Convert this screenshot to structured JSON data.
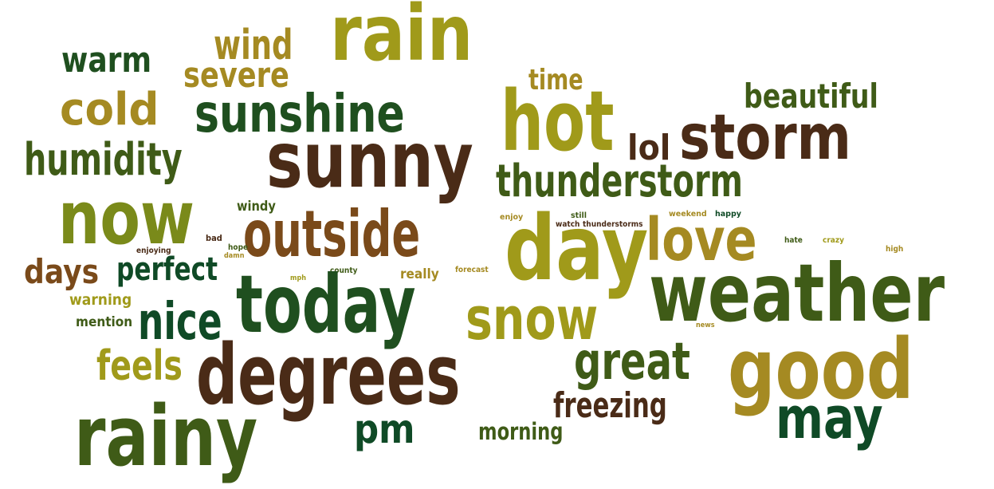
{
  "palette": {
    "dark_green": "#1f4f1f",
    "forest_green": "#3f5b17",
    "deep_green": "#0f4a26",
    "olive": "#a09a1a",
    "mustard": "#a58a22",
    "brown": "#7a4a1a",
    "dark_brown": "#4a2b17",
    "olive_green": "#7a8a1a"
  },
  "words": [
    {
      "text": "rain"
    },
    {
      "text": "wind"
    },
    {
      "text": "warm"
    },
    {
      "text": "severe"
    },
    {
      "text": "time"
    },
    {
      "text": "cold"
    },
    {
      "text": "sunshine"
    },
    {
      "text": "hot"
    },
    {
      "text": "beautiful"
    },
    {
      "text": "storm"
    },
    {
      "text": "lol"
    },
    {
      "text": "humidity"
    },
    {
      "text": "sunny"
    },
    {
      "text": "thunderstorm"
    },
    {
      "text": "now"
    },
    {
      "text": "windy"
    },
    {
      "text": "outside"
    },
    {
      "text": "day"
    },
    {
      "text": "love"
    },
    {
      "text": "enjoy"
    },
    {
      "text": "still"
    },
    {
      "text": "weekend"
    },
    {
      "text": "happy"
    },
    {
      "text": "watch"
    },
    {
      "text": "thunderstorms"
    },
    {
      "text": "bad"
    },
    {
      "text": "hope"
    },
    {
      "text": "damn"
    },
    {
      "text": "enjoying"
    },
    {
      "text": "hate"
    },
    {
      "text": "crazy"
    },
    {
      "text": "high"
    },
    {
      "text": "days"
    },
    {
      "text": "perfect"
    },
    {
      "text": "mph"
    },
    {
      "text": "county"
    },
    {
      "text": "really"
    },
    {
      "text": "forecast"
    },
    {
      "text": "weather"
    },
    {
      "text": "warning"
    },
    {
      "text": "today"
    },
    {
      "text": "snow"
    },
    {
      "text": "mention"
    },
    {
      "text": "nice"
    },
    {
      "text": "news"
    },
    {
      "text": "great"
    },
    {
      "text": "good"
    },
    {
      "text": "feels"
    },
    {
      "text": "degrees"
    },
    {
      "text": "freezing"
    },
    {
      "text": "may"
    },
    {
      "text": "rainy"
    },
    {
      "text": "pm"
    },
    {
      "text": "morning"
    }
  ]
}
